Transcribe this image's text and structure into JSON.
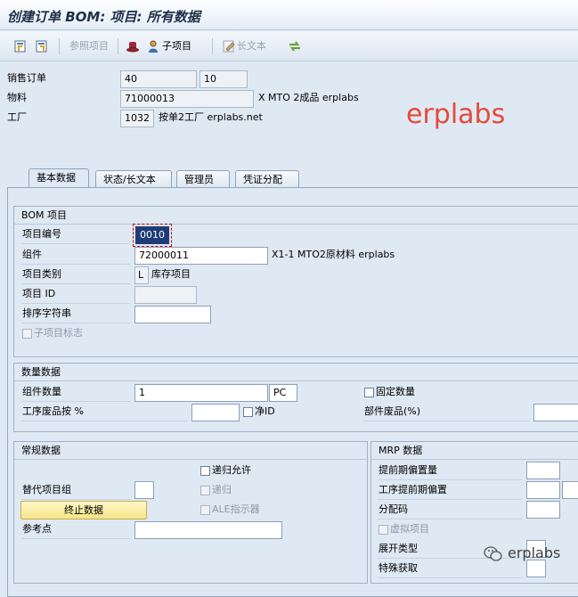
{
  "window": {
    "title": "创建订单 BOM: 项目: 所有数据"
  },
  "toolbar": {
    "ref_item_label": "参照项目",
    "sub_item_label": "子项目",
    "long_text_label": "长文本"
  },
  "header": {
    "sales_order_label": "销售订单",
    "sales_order": "40",
    "sales_order_item": "10",
    "material_label": "物料",
    "material": "71000013",
    "material_desc": "X MTO 2成品 erplabs",
    "plant_label": "工厂",
    "plant": "1032",
    "plant_desc": "按单2工厂 erplabs.net"
  },
  "watermark": "erplabs",
  "tabs": [
    {
      "label": "基本数据",
      "active": true
    },
    {
      "label": "状态/长文本",
      "active": false
    },
    {
      "label": "管理员",
      "active": false
    },
    {
      "label": "凭证分配",
      "active": false
    }
  ],
  "bom_item": {
    "group_title": "BOM 项目",
    "item_no_label": "项目编号",
    "item_no": "0010",
    "component_label": "组件",
    "component": "72000011",
    "component_desc": "X1-1 MTO2原材料 erplabs",
    "item_cat_label": "项目类别",
    "item_cat": "L",
    "item_cat_desc": "库存项目",
    "item_id_label": "项目 ID",
    "item_id": "",
    "sort_string_label": "排序字符串",
    "sort_string": "",
    "sub_item_flag_label": "子项目标志"
  },
  "quantity": {
    "group_title": "数量数据",
    "comp_qty_label": "组件数量",
    "comp_qty": "1",
    "unit": "PC",
    "fixed_qty_label": "固定数量",
    "op_scrap_label": "工序废品按 %",
    "op_scrap": "",
    "net_id_label": "净ID",
    "comp_scrap_label": "部件废品(%)",
    "comp_scrap": ""
  },
  "general": {
    "group_title": "常规数据",
    "recursive_label": "递归允许",
    "alt_group_label": "替代项目组",
    "alt_group": "",
    "recursive2_label": "递归",
    "end_data_button": "终止数据",
    "ale_label": "ALE指示器",
    "ref_point_label": "参考点",
    "ref_point": ""
  },
  "mrp": {
    "group_title": "MRP 数据",
    "lead_offset_label": "提前期偏置量",
    "op_lead_offset_label": "工序提前期偏置",
    "dist_key_label": "分配码",
    "phantom_label": "虚拟项目",
    "explosion_type_label": "展开类型",
    "special_proc_label": "特殊获取"
  },
  "wechat_mark": "erplabs"
}
